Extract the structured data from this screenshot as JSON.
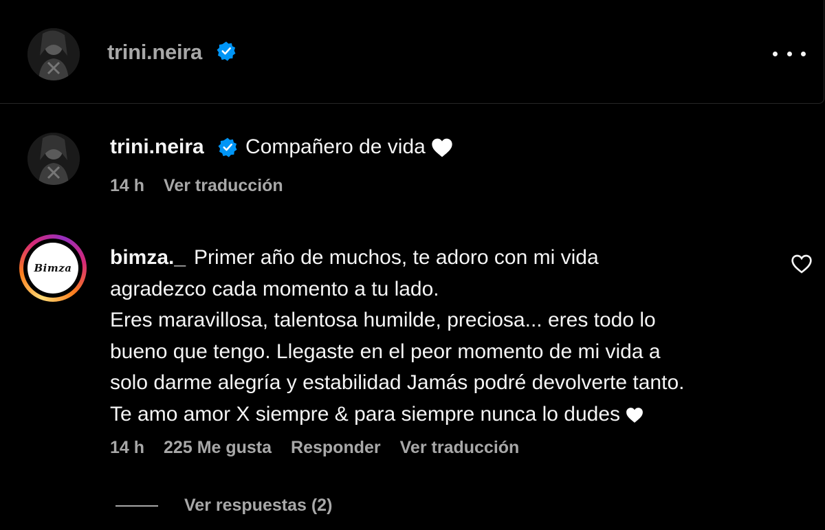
{
  "header": {
    "username": "trini.neira",
    "verified": true,
    "more_icon": "more-horizontal-icon"
  },
  "caption": {
    "username": "trini.neira",
    "verified": true,
    "text": "Compañero de vida",
    "emoji": "white-heart-icon",
    "time": "14 h",
    "translate": "Ver traducción"
  },
  "comment": {
    "username": "bimza._",
    "avatar_text": "Bimza",
    "lines": [
      "Primer año de muchos, te adoro con mi vida",
      "agradezco cada momento a tu lado.",
      "Eres maravillosa, talentosa humilde, preciosa... eres todo lo",
      "bueno que tengo. Llegaste en el peor momento de mi vida a",
      "solo darme alegría y estabilidad Jamás podré devolverte tanto.",
      "Te amo amor X siempre & para siempre nunca lo dudes"
    ],
    "time": "14 h",
    "likes": "225 Me gusta",
    "reply": "Responder",
    "translate": "Ver traducción",
    "view_replies": "Ver respuestas (2)"
  },
  "colors": {
    "background": "#000000",
    "text": "#f5f5f5",
    "secondary": "#a8a8a8",
    "verified": "#0095f6"
  }
}
